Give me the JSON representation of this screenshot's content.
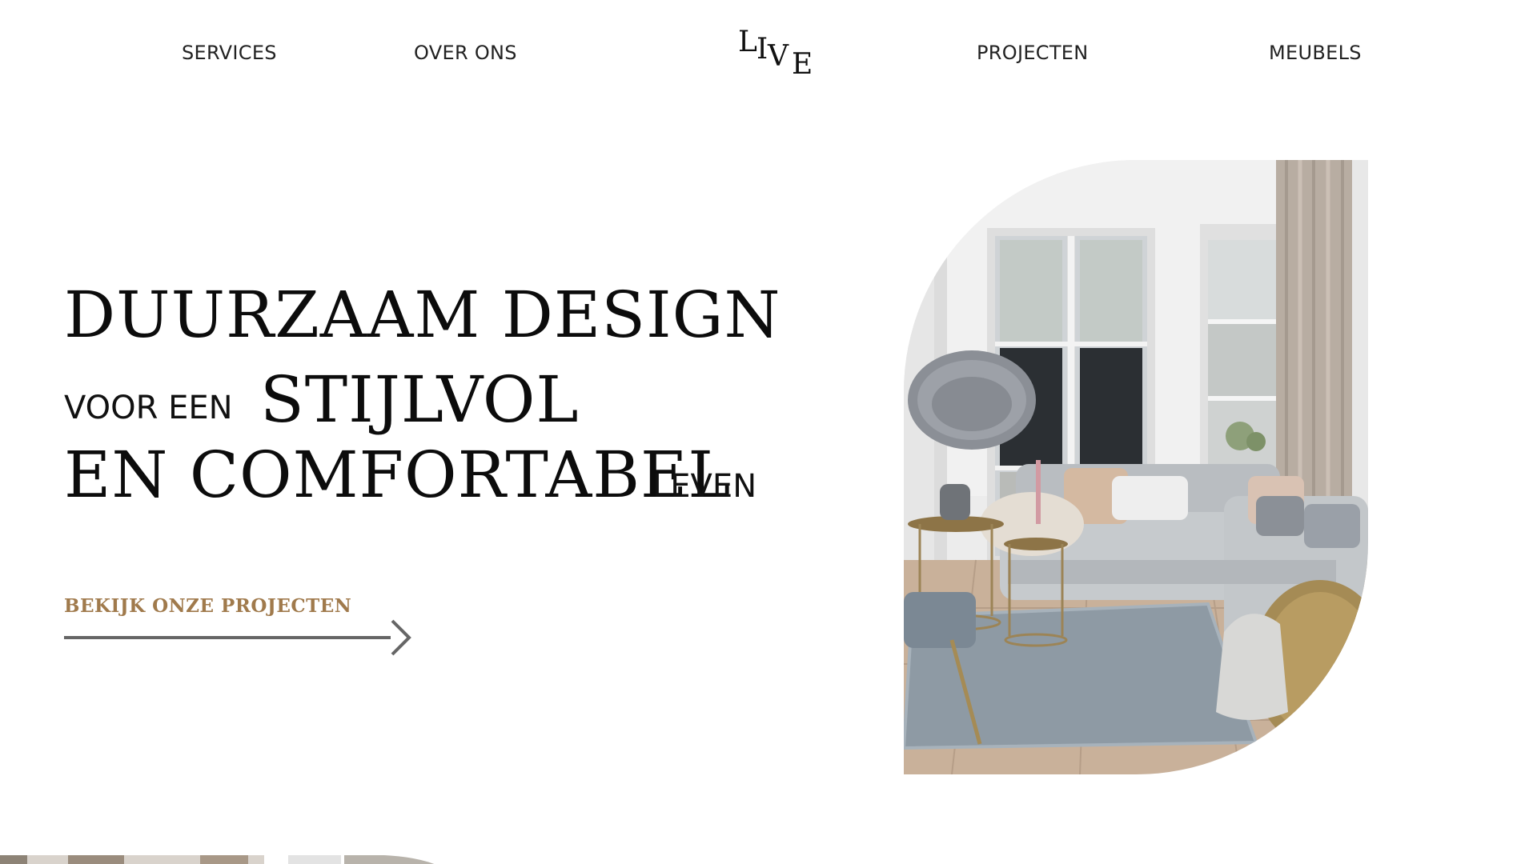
{
  "nav": {
    "items": [
      {
        "label": "SERVICES"
      },
      {
        "label": "OVER ONS"
      },
      {
        "label": "PROJECTEN"
      },
      {
        "label": "MEUBELS"
      }
    ],
    "logo": {
      "letters": [
        "L",
        "I",
        "V",
        "E"
      ]
    }
  },
  "hero": {
    "line1": "DUURZAAM DESIGN",
    "line2_small": "VOOR EEN",
    "line2_big": "STIJLVOL",
    "line3_big": "EN COMFORTABEL",
    "line3_small": "LEVEN",
    "cta_label": "BEKIJK ONZE PROJECTEN"
  },
  "colors": {
    "accent": "#a07a4c",
    "text": "#0c0c0c",
    "arrow": "#666666",
    "background": "#ffffff"
  },
  "icons": {
    "cta_arrow": "arrow-right-icon",
    "hero_image": "living-room-photo"
  }
}
